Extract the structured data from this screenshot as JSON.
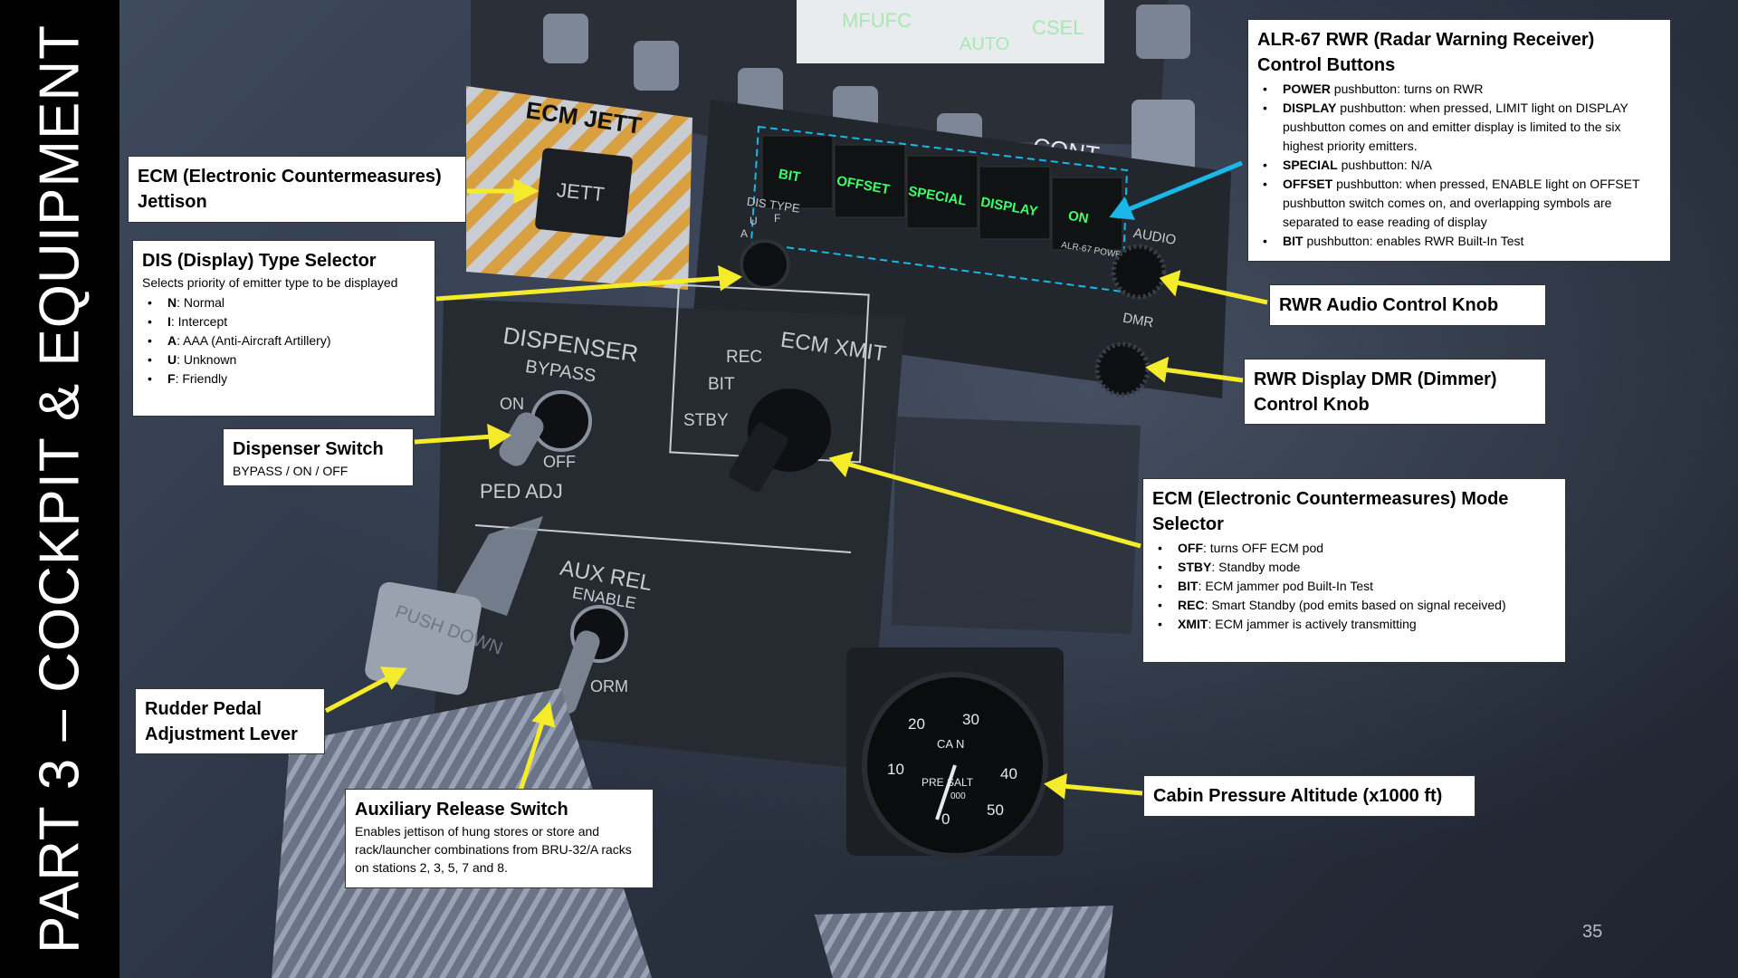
{
  "slide": {
    "sidebar_title": "PART 3 – COCKPIT & EQUIPMENT",
    "page_number": "35"
  },
  "panel_labels": {
    "ecm_jett": "ECM JETT",
    "jett": "JETT",
    "cont": "CONT",
    "dis_type": "DIS TYPE",
    "dis_letters": [
      "U",
      "F",
      "A"
    ],
    "rwr_buttons": [
      "BIT",
      "OFFSET",
      "SPECIAL",
      "DISPLAY",
      "ON"
    ],
    "alr_power": "ALR-67 POWER",
    "audio": "AUDIO",
    "dmr": "DMR",
    "dispenser": "DISPENSER",
    "bypass": "BYPASS",
    "on": "ON",
    "off": "OFF",
    "ped_adj": "PED ADJ",
    "ecm_xmit": "ECM XMIT",
    "rec": "REC",
    "bit": "BIT",
    "stby": "STBY",
    "aux_rel": "AUX REL",
    "enable": "ENABLE",
    "norm": "ORM",
    "push_down": "PUSH DOWN",
    "gauge_upper": "CA   N",
    "gauge_lower": "PRE   SALT",
    "gauge_000": "000",
    "gauge_ticks": [
      "20",
      "30",
      "10",
      "40",
      "50",
      "0"
    ],
    "display_texts": [
      "MFUFC",
      "AUTO",
      "CSEL"
    ]
  },
  "callouts": {
    "ecm_jettison": {
      "title": "ECM (Electronic Countermeasures) Jettison"
    },
    "dis_selector": {
      "title": "DIS (Display) Type Selector",
      "desc": "Selects priority of emitter type to be displayed",
      "items": [
        {
          "key": "N",
          "text": ": Normal"
        },
        {
          "key": "I",
          "text": ": Intercept"
        },
        {
          "key": "A",
          "text": ": AAA (Anti-Aircraft Artillery)"
        },
        {
          "key": "U",
          "text": ": Unknown"
        },
        {
          "key": "F",
          "text": ": Friendly"
        }
      ]
    },
    "dispenser_switch": {
      "title": "Dispenser Switch",
      "desc": "BYPASS / ON / OFF"
    },
    "rudder_pedal": {
      "title": "Rudder Pedal Adjustment Lever"
    },
    "aux_release": {
      "title": "Auxiliary Release Switch",
      "desc": "Enables jettison of hung stores or store and rack/launcher combinations from BRU-32/A racks on stations 2, 3, 5, 7 and 8."
    },
    "rwr_controls": {
      "title": "ALR-67 RWR (Radar Warning Receiver) Control Buttons",
      "items": [
        {
          "key": "POWER",
          "text": " pushbutton: turns on RWR"
        },
        {
          "key": "DISPLAY",
          "text": " pushbutton:  when pressed, LIMIT light on DISPLAY pushbutton comes on and emitter display is limited to the six highest priority emitters."
        },
        {
          "key": "SPECIAL",
          "text": " pushbutton: N/A"
        },
        {
          "key": "OFFSET",
          "text": " pushbutton: when pressed, ENABLE light on OFFSET pushbutton switch comes on, and overlapping symbols are separated to ease reading of display"
        },
        {
          "key": "BIT",
          "text": " pushbutton: enables RWR Built-In Test"
        }
      ]
    },
    "rwr_audio": {
      "title": "RWR Audio Control Knob"
    },
    "rwr_dmr": {
      "title": "RWR Display DMR (Dimmer) Control Knob"
    },
    "ecm_mode": {
      "title": "ECM (Electronic Countermeasures) Mode Selector",
      "items": [
        {
          "key": "OFF",
          "text": ": turns OFF ECM pod"
        },
        {
          "key": "STBY",
          "text": ": Standby mode"
        },
        {
          "key": "BIT",
          "text": ": ECM jammer pod Built-In Test"
        },
        {
          "key": "REC",
          "text": ": Smart Standby (pod emits based on signal received)"
        },
        {
          "key": "XMIT",
          "text": ": ECM jammer is actively transmitting"
        }
      ]
    },
    "cabin_pressure": {
      "title": "Cabin Pressure Altitude (x1000 ft)"
    }
  },
  "colors": {
    "arrow": "#f4ec2a",
    "highlight_arrow": "#1ab8e8",
    "button_glow": "#3dff6a",
    "hazard_stripe": "#d8a040"
  }
}
